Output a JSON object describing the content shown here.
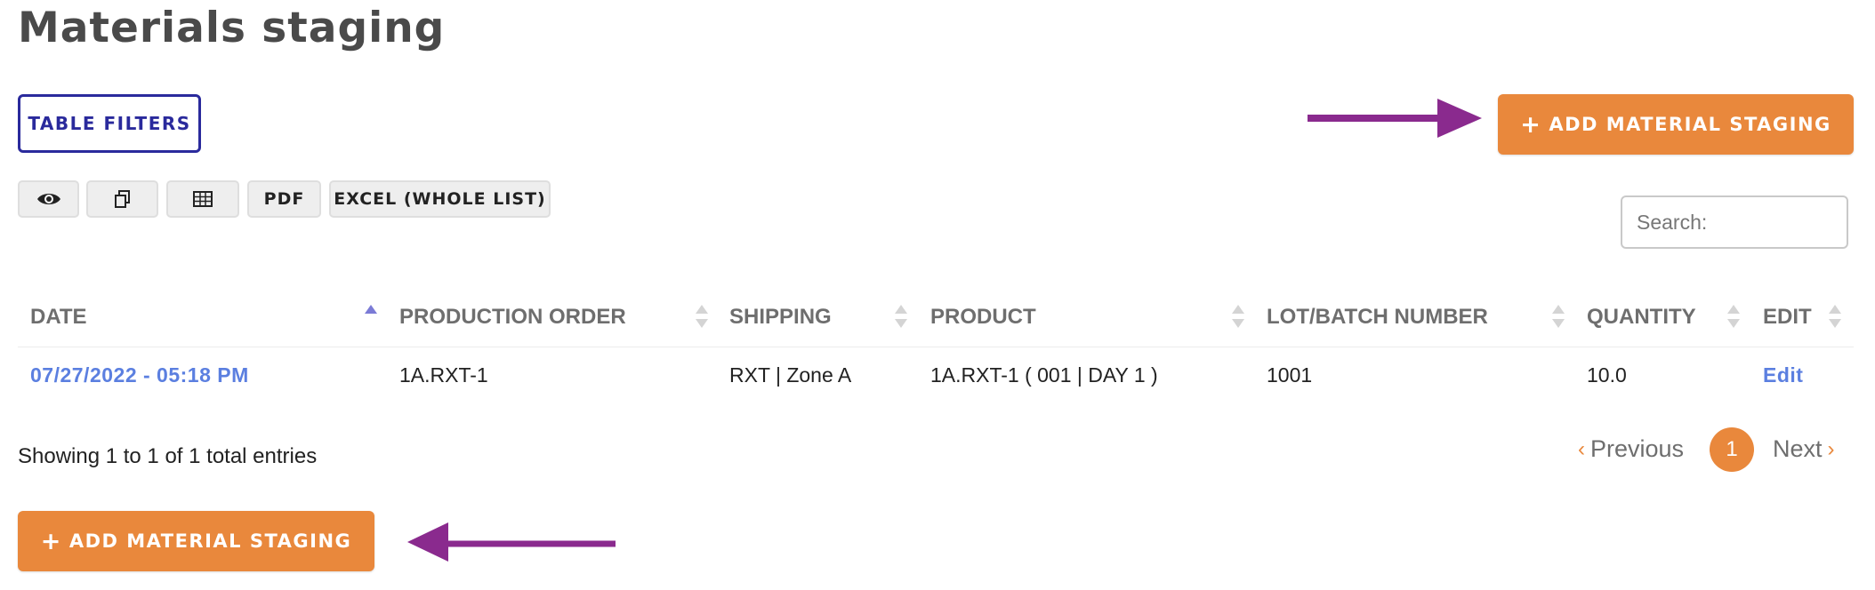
{
  "page": {
    "title": "Materials staging"
  },
  "toolbar": {
    "filters_label": "TABLE FILTERS",
    "add_label": "ADD MATERIAL STAGING",
    "add_icon": "plus-icon",
    "buttons": [
      {
        "icon": "eye-icon"
      },
      {
        "icon": "copy-icon"
      },
      {
        "icon": "table-icon"
      },
      {
        "label": "PDF"
      },
      {
        "label": "EXCEL (WHOLE LIST)"
      }
    ]
  },
  "search": {
    "placeholder": "Search:",
    "value": ""
  },
  "table": {
    "columns": [
      "DATE",
      "PRODUCTION ORDER",
      "SHIPPING",
      "PRODUCT",
      "LOT/BATCH NUMBER",
      "QUANTITY",
      "EDIT"
    ],
    "sorted_column": "DATE",
    "sort_direction": "ascending",
    "rows": [
      {
        "date": "07/27/2022 - 05:18 PM",
        "production_order": "1A.RXT-1",
        "shipping": "RXT | Zone A",
        "product": "1A.RXT-1 ( 001 | DAY 1 )",
        "lot_batch_number": "1001",
        "quantity": "10.0",
        "edit": "Edit"
      }
    ]
  },
  "footer": {
    "info": "Showing 1 to 1 of 1 total entries"
  },
  "pagination": {
    "previous": "Previous",
    "current": "1",
    "next": "Next"
  },
  "colors": {
    "accent_orange": "#e9883c",
    "filter_border": "#2a2a9c",
    "link_blue": "#5b7fe0",
    "arrow_purple": "#8a2a8e",
    "header_gray": "#6e6e6e"
  }
}
